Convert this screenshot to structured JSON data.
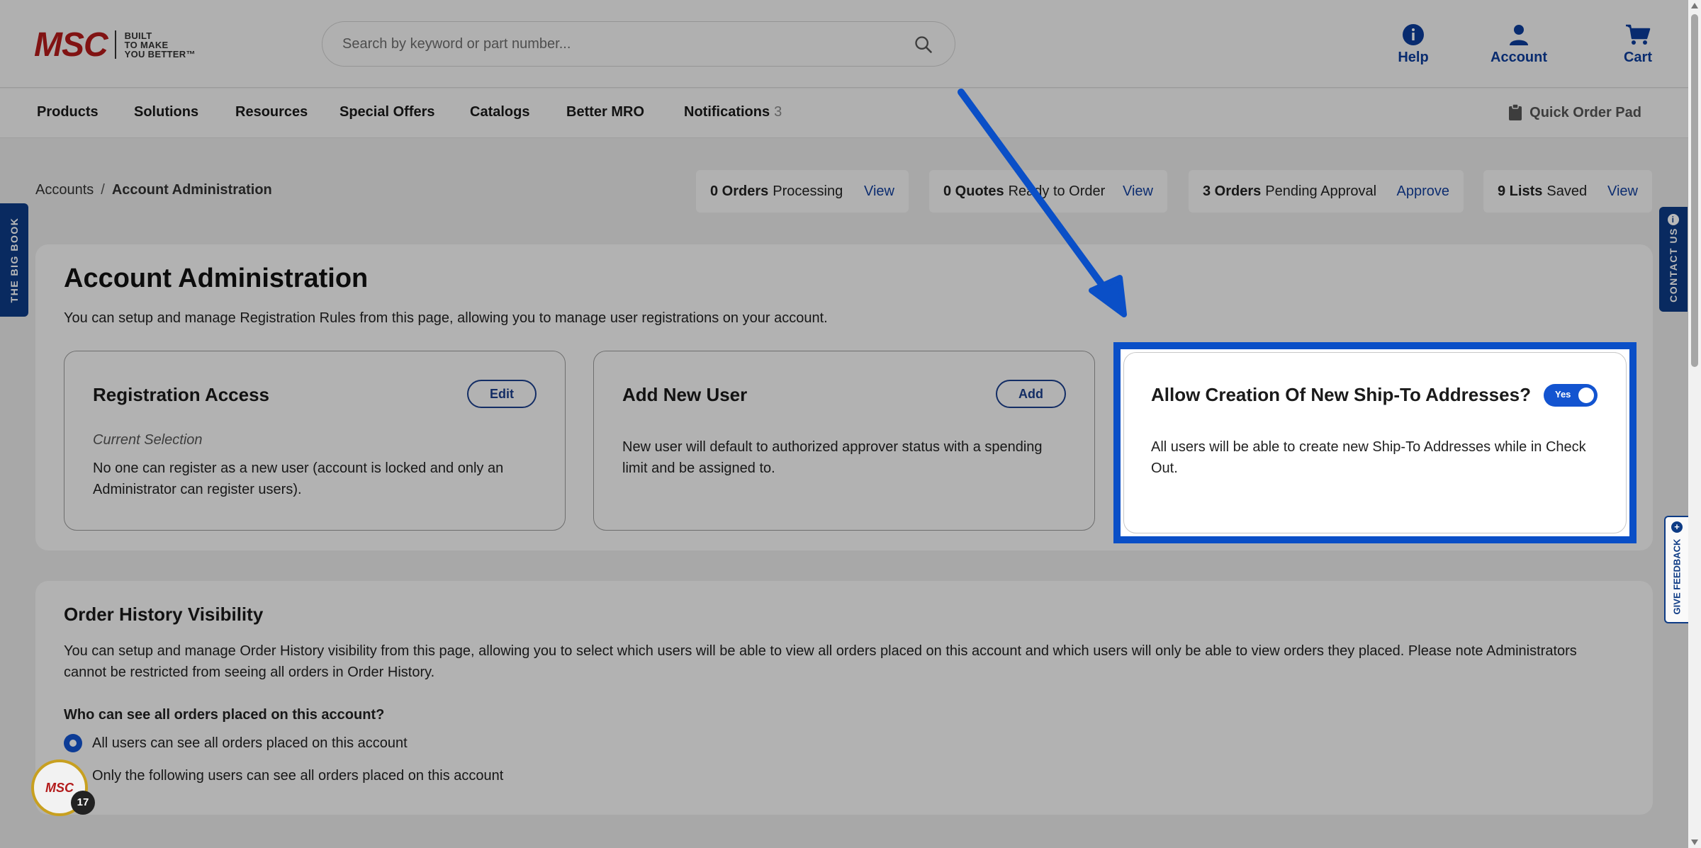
{
  "header": {
    "logo": {
      "mark": "MSC",
      "tagline": [
        "BUILT",
        "TO MAKE",
        "YOU BETTER™"
      ]
    },
    "search_placeholder": "Search by keyword or part number...",
    "links": [
      {
        "label": "Help",
        "icon": "info-circle-icon"
      },
      {
        "label": "Account",
        "icon": "user-icon"
      },
      {
        "label": "Cart",
        "icon": "cart-icon"
      }
    ]
  },
  "nav": {
    "items": [
      "Products",
      "Solutions",
      "Resources",
      "Special Offers",
      "Catalogs",
      "Better MRO",
      "Notifications"
    ],
    "notifications_count": "3",
    "quick_order": "Quick Order Pad"
  },
  "breadcrumb": {
    "parent": "Accounts",
    "current": "Account Administration"
  },
  "stats": [
    {
      "count": "0 Orders",
      "label": "Processing",
      "action": "View"
    },
    {
      "count": "0 Quotes",
      "label": "Ready to Order",
      "action": "View"
    },
    {
      "count": "3 Orders",
      "label": "Pending Approval",
      "action": "Approve"
    },
    {
      "count": "9 Lists",
      "label": "Saved",
      "action": "View"
    }
  ],
  "admin": {
    "title": "Account Administration",
    "description": "You can setup and manage Registration Rules from this page, allowing you to manage user registrations on your account.",
    "registration": {
      "title": "Registration Access",
      "button": "Edit",
      "current_label": "Current Selection",
      "text": "No one can register as a new user (account is locked and only an Administrator can register users)."
    },
    "add_user": {
      "title": "Add New User",
      "button": "Add",
      "text": "New user will default to authorized approver status with a spending limit and be assigned to."
    },
    "ship_to": {
      "title": "Allow Creation Of New Ship-To Addresses?",
      "toggle_label": "Yes",
      "text": "All users will be able to create new Ship-To Addresses while in Check Out."
    }
  },
  "order_history": {
    "title": "Order History Visibility",
    "description": "You can setup and manage Order History visibility from this page, allowing you to select which users will be able to view all orders placed on this account and which users will only be able to view orders they placed. Please note Administrators cannot be restricted from seeing all orders in Order History.",
    "question": "Who can see all orders placed on this account?",
    "options": [
      {
        "label": "All users can see all orders placed on this account",
        "selected": true
      },
      {
        "label": "Only the following users can see all orders placed on this account",
        "selected": false
      }
    ]
  },
  "side_tabs": {
    "big_book": "THE BIG BOOK",
    "contact": "CONTACT US",
    "feedback": "GIVE FEEDBACK"
  },
  "floating_badge": {
    "logo": "MSC",
    "count": "17"
  },
  "colors": {
    "brand_red": "#b31b1b",
    "brand_blue": "#0d3b85",
    "highlight_blue": "#0a4fc7",
    "link_blue": "#123f9b"
  }
}
